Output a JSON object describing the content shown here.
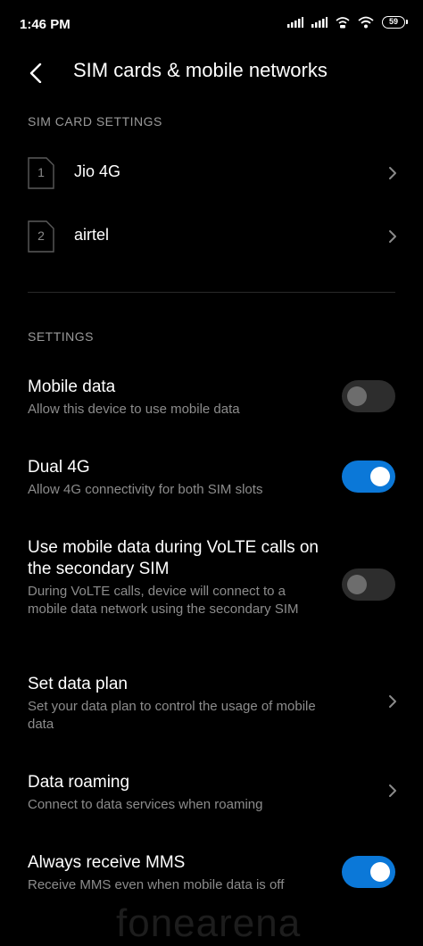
{
  "status_bar": {
    "time": "1:46 PM",
    "battery_level": "59",
    "icons": [
      "signal-icon",
      "signal-icon",
      "volte-icon",
      "wifi-icon",
      "battery-icon"
    ]
  },
  "app_bar": {
    "back_icon": "arrow-back-icon",
    "title": "SIM cards & mobile networks"
  },
  "sim_section": {
    "header": "SIM CARD SETTINGS",
    "sims": [
      {
        "slot": "1",
        "name": "Jio 4G"
      },
      {
        "slot": "2",
        "name": "airtel"
      }
    ]
  },
  "settings_section": {
    "header": "SETTINGS",
    "items": [
      {
        "title": "Mobile data",
        "subtitle": "Allow this device to use mobile data",
        "control": "toggle",
        "enabled": false
      },
      {
        "title": "Dual 4G",
        "subtitle": "Allow 4G connectivity for both SIM slots",
        "control": "toggle",
        "enabled": true
      },
      {
        "title": "Use mobile data during VoLTE calls on the secondary SIM",
        "subtitle": "During VoLTE calls, device will connect to a mobile data network using the secondary SIM",
        "control": "toggle",
        "enabled": false
      },
      {
        "title": "Set data plan",
        "subtitle": "Set your data plan to control the usage of mobile data",
        "control": "chevron"
      },
      {
        "title": "Data roaming",
        "subtitle": "Connect to data services when roaming",
        "control": "chevron"
      },
      {
        "title": "Always receive MMS",
        "subtitle": "Receive MMS even when mobile data is off",
        "control": "toggle",
        "enabled": true
      }
    ]
  },
  "watermark": "fonearena",
  "colors": {
    "background": "#000000",
    "toggle_on": "#0b78d8",
    "toggle_off": "#2d2d2d",
    "secondary_text": "#8c8c8c"
  }
}
